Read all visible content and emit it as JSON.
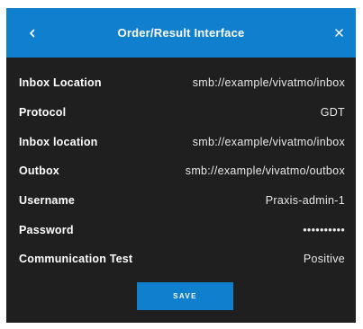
{
  "header": {
    "title": "Order/Result Interface",
    "back_icon": "chevron-left-icon",
    "close_icon": "close-icon"
  },
  "rows": [
    {
      "label": "Inbox Location",
      "value": "smb://example/vivatmo/inbox"
    },
    {
      "label": "Protocol",
      "value": "GDT"
    },
    {
      "label": "Inbox location",
      "value": "smb://example/vivatmo/inbox"
    },
    {
      "label": "Outbox",
      "value": "smb://example/vivatmo/outbox"
    },
    {
      "label": "Username",
      "value": "Praxis-admin-1"
    },
    {
      "label": "Password",
      "value": "••••••••••"
    },
    {
      "label": "Communication Test",
      "value": "Positive"
    }
  ],
  "actions": {
    "save_label": "SAVE"
  },
  "colors": {
    "accent": "#0f7fce",
    "dialog_background": "#1f1f1f",
    "text": "#ffffff"
  }
}
